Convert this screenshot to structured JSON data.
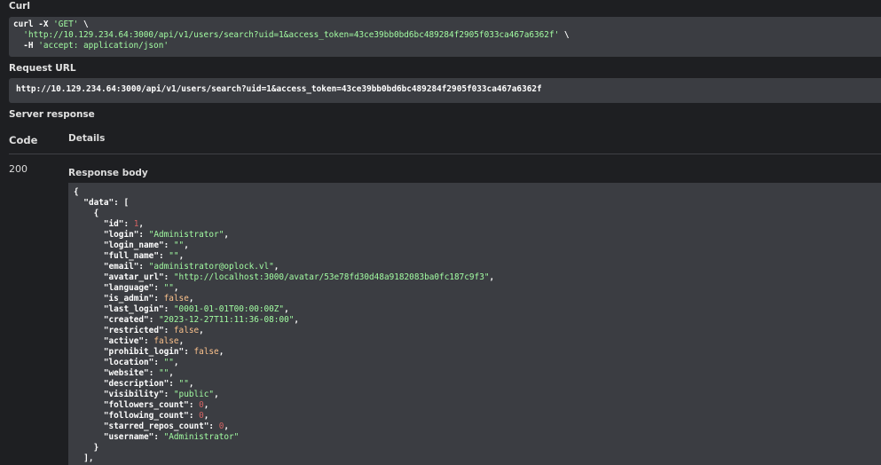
{
  "curl": {
    "label": "Curl",
    "line1_cmd": "curl -X ",
    "line1_method": "'GET'",
    "line1_tail": " \\",
    "line2_url": "'http://10.129.234.64:3000/api/v1/users/search?uid=1&access_token=43ce39bb0bd6bc489284f2905f033ca467a6362f'",
    "line2_tail": " \\",
    "line3_flag": "  -H ",
    "line3_header": "'accept: application/json'"
  },
  "request_url": {
    "label": "Request URL",
    "value": "http://10.129.234.64:3000/api/v1/users/search?uid=1&access_token=43ce39bb0bd6bc489284f2905f033ca467a6362f"
  },
  "server_response": {
    "label": "Server response",
    "col_code": "Code",
    "col_details": "Details",
    "code": "200",
    "body_label": "Response body"
  },
  "response": {
    "fields": [
      {
        "key": "\"id\"",
        "value": "1",
        "type": "n"
      },
      {
        "key": "\"login\"",
        "value": "\"Administrator\"",
        "type": "s"
      },
      {
        "key": "\"login_name\"",
        "value": "\"\"",
        "type": "s"
      },
      {
        "key": "\"full_name\"",
        "value": "\"\"",
        "type": "s"
      },
      {
        "key": "\"email\"",
        "value": "\"administrator@oplock.vl\"",
        "type": "s"
      },
      {
        "key": "\"avatar_url\"",
        "value": "\"http://localhost:3000/avatar/53e78fd30d48a9182083ba0fc187c9f3\"",
        "type": "s"
      },
      {
        "key": "\"language\"",
        "value": "\"\"",
        "type": "s"
      },
      {
        "key": "\"is_admin\"",
        "value": "false",
        "type": "b"
      },
      {
        "key": "\"last_login\"",
        "value": "\"0001-01-01T00:00:00Z\"",
        "type": "s"
      },
      {
        "key": "\"created\"",
        "value": "\"2023-12-27T11:11:36-08:00\"",
        "type": "s"
      },
      {
        "key": "\"restricted\"",
        "value": "false",
        "type": "b"
      },
      {
        "key": "\"active\"",
        "value": "false",
        "type": "b"
      },
      {
        "key": "\"prohibit_login\"",
        "value": "false",
        "type": "b"
      },
      {
        "key": "\"location\"",
        "value": "\"\"",
        "type": "s"
      },
      {
        "key": "\"website\"",
        "value": "\"\"",
        "type": "s"
      },
      {
        "key": "\"description\"",
        "value": "\"\"",
        "type": "s"
      },
      {
        "key": "\"visibility\"",
        "value": "\"public\"",
        "type": "s"
      },
      {
        "key": "\"followers_count\"",
        "value": "0",
        "type": "n"
      },
      {
        "key": "\"following_count\"",
        "value": "0",
        "type": "n"
      },
      {
        "key": "\"starred_repos_count\"",
        "value": "0",
        "type": "n"
      },
      {
        "key": "\"username\"",
        "value": "\"Administrator\"",
        "type": "s"
      }
    ]
  },
  "colors": {
    "background": "#1e1f22",
    "code_bg": "#3b3d42",
    "string": "#a2fca2",
    "number": "#d36363",
    "boolean": "#fcc28c"
  }
}
